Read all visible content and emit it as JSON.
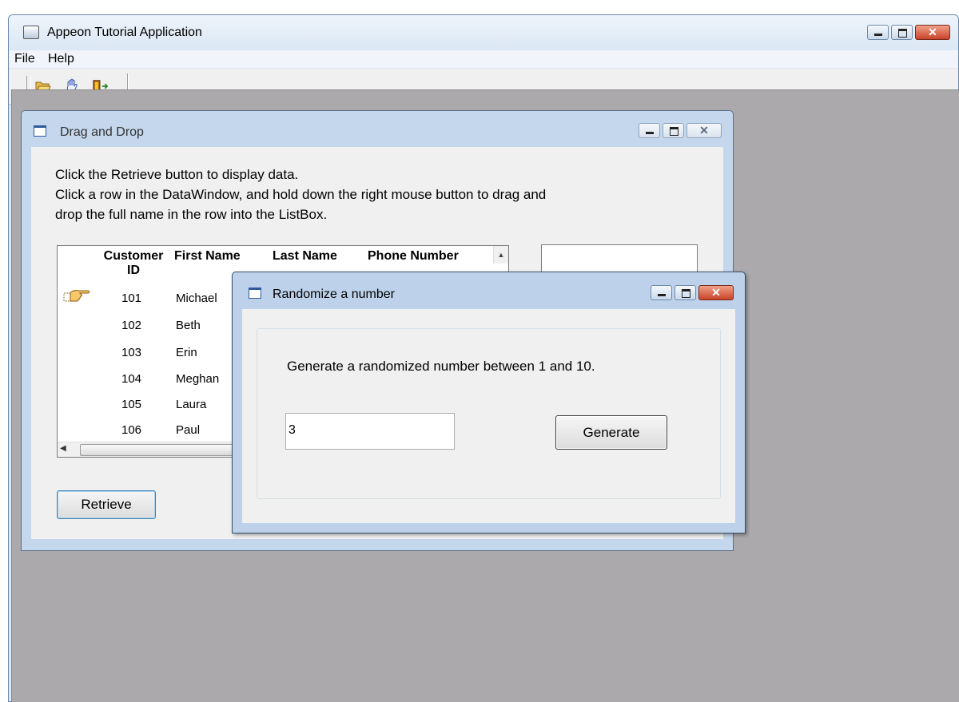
{
  "app": {
    "title": "Appeon Tutorial Application",
    "menu": [
      "File",
      "Help"
    ],
    "toolbar_icons": [
      "open-folder-icon",
      "hand-icon",
      "exit-door-icon"
    ]
  },
  "drag_drop": {
    "title": "Drag and Drop",
    "instructions": [
      "Click the Retrieve button to display data.",
      "Click a row in the DataWindow, and hold down the right mouse button to drag and",
      "drop the full name in the row into the ListBox."
    ],
    "columns": [
      "Customer\nID",
      "First Name",
      "Last Name",
      "Phone Number"
    ],
    "rows": [
      {
        "id": "101",
        "first": "Michael"
      },
      {
        "id": "102",
        "first": "Beth"
      },
      {
        "id": "103",
        "first": "Erin"
      },
      {
        "id": "104",
        "first": "Meghan"
      },
      {
        "id": "105",
        "first": "Laura"
      },
      {
        "id": "106",
        "first": "Paul"
      }
    ],
    "retrieve_label": "Retrieve"
  },
  "randomize": {
    "title": "Randomize a number",
    "description": "Generate a randomized number between 1 and 10.",
    "value": "3",
    "generate_label": "Generate"
  }
}
